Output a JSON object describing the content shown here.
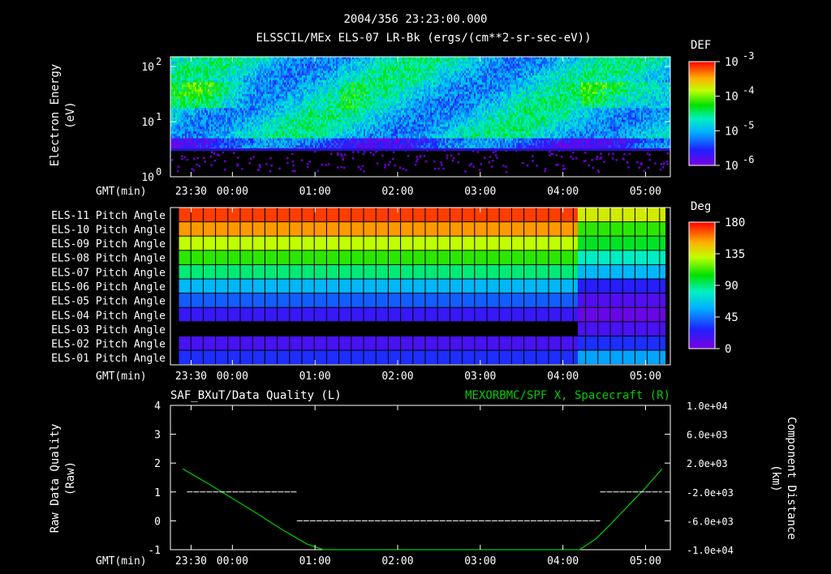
{
  "header": {
    "timestamp": "2004/356 23:23:00.000"
  },
  "chart_data": [
    {
      "type": "heatmap",
      "title": "ELSSCIL/MEx ELS-07 LR-Bk  (ergs/(cm**2-sr-sec-eV))",
      "ylabel_line1": "Electron Energy",
      "ylabel_line2": "(eV)",
      "y_scale": "log",
      "ylim": [
        1,
        150
      ],
      "y_ticks": [
        "10^0",
        "10^1",
        "10^2"
      ],
      "x_axis_label": "GMT(min)",
      "x_ticks": [
        "23:30",
        "00:00",
        "01:00",
        "02:00",
        "03:00",
        "04:00",
        "05:00"
      ],
      "colorbar": {
        "title": "DEF",
        "scale": "log",
        "range": [
          1e-06,
          0.001
        ],
        "ticks": [
          "10^-3",
          "10^-4",
          "10^-5",
          "10^-6"
        ]
      }
    },
    {
      "type": "heatmap",
      "x_axis_label": "GMT(min)",
      "x_ticks": [
        "23:30",
        "00:00",
        "01:00",
        "02:00",
        "03:00",
        "04:00",
        "05:00"
      ],
      "rows": [
        {
          "label": "ELS-11 Pitch Angle",
          "before": 170,
          "after": 135
        },
        {
          "label": "ELS-10 Pitch Angle",
          "before": 155,
          "after": 110
        },
        {
          "label": "ELS-09 Pitch Angle",
          "before": 130,
          "after": 100
        },
        {
          "label": "ELS-08 Pitch Angle",
          "before": 110,
          "after": 80
        },
        {
          "label": "ELS-07 Pitch Angle",
          "before": 90,
          "after": 60
        },
        {
          "label": "ELS-06 Pitch Angle",
          "before": 60,
          "after": 25
        },
        {
          "label": "ELS-05 Pitch Angle",
          "before": 40,
          "after": 12
        },
        {
          "label": "ELS-04 Pitch Angle",
          "before": 20,
          "after": 5
        },
        {
          "label": "ELS-03 Pitch Angle",
          "before": null,
          "after": 15
        },
        {
          "label": "ELS-02 Pitch Angle",
          "before": 15,
          "after": 30
        },
        {
          "label": "ELS-01 Pitch Angle",
          "before": 30,
          "after": 55
        }
      ],
      "colorbar": {
        "title": "Deg",
        "range": [
          0,
          180
        ],
        "ticks": [
          "180",
          "135",
          "90",
          "45",
          "0"
        ]
      }
    },
    {
      "type": "line",
      "title_left": "SAF_BXuT/Data Quality (L)",
      "title_right": "MEXORBMC/SPF X, Spacecraft (R)",
      "ylabel_left_line1": "Raw Data Quality",
      "ylabel_left_line2": "(Raw)",
      "ylabel_right_line1": "Component Distance",
      "ylabel_right_line2": "(km)",
      "x_axis_label": "GMT(min)",
      "x_ticks": [
        "23:30",
        "00:00",
        "01:00",
        "02:00",
        "03:00",
        "04:00",
        "05:00"
      ],
      "ylim_left": [
        -1,
        4
      ],
      "y_ticks_left": [
        "4",
        "3",
        "2",
        "1",
        "0",
        "-1"
      ],
      "ylim_right": [
        -10000,
        10000
      ],
      "y_ticks_right": [
        "1.0e+04",
        "6.0e+03",
        "2.0e+03",
        "-2.0e+03",
        "-6.0e+03",
        "-1.0e+04"
      ],
      "series": [
        {
          "color": "#00cc00",
          "x_hours": [
            -0.6,
            -0.3,
            0,
            0.3,
            0.6,
            0.9,
            1.1,
            4.2,
            4.4,
            4.6,
            4.8,
            5.0,
            5.2
          ],
          "y": [
            1200,
            -800,
            -2900,
            -5000,
            -7200,
            -9200,
            -10000,
            -10000,
            -8500,
            -6200,
            -3800,
            -1400,
            1200
          ]
        },
        {
          "color": "#ffffff",
          "segments": [
            {
              "x_start": -0.55,
              "x_end": 0.78,
              "y": 1
            },
            {
              "x_start": 0.78,
              "x_end": 4.45,
              "y": 0
            },
            {
              "x_start": 4.45,
              "x_end": 5.2,
              "y": 1
            }
          ]
        }
      ]
    }
  ]
}
